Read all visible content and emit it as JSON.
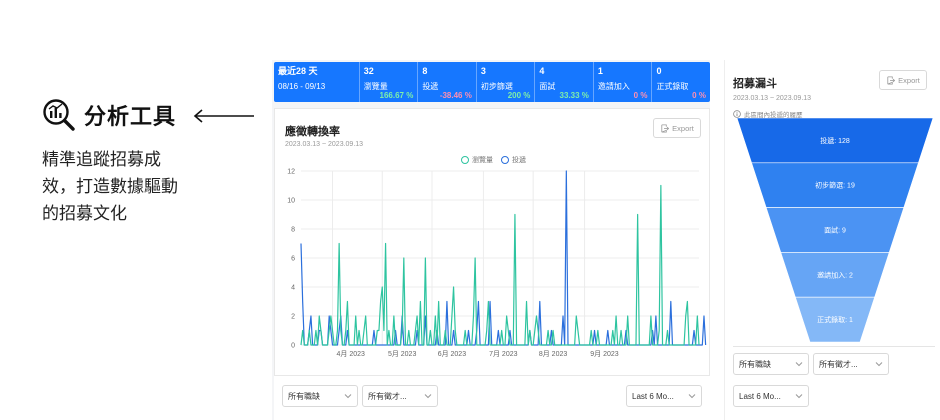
{
  "promo": {
    "title": "分析工具",
    "desc_lines": [
      "精準追蹤招募成",
      "效，打造數據驅動",
      "的招募文化"
    ]
  },
  "stats": [
    {
      "value": "最近28 天",
      "label": "08/16 - 09/13",
      "pct": "",
      "pct_color": "green"
    },
    {
      "value": "32",
      "label": "瀏覽量",
      "pct": "166.67 %",
      "pct_color": "green"
    },
    {
      "value": "8",
      "label": "投遞",
      "pct": "-38.46 %",
      "pct_color": "pink"
    },
    {
      "value": "3",
      "label": "初步篩選",
      "pct": "200 %",
      "pct_color": "green"
    },
    {
      "value": "4",
      "label": "面試",
      "pct": "33.33 %",
      "pct_color": "green"
    },
    {
      "value": "1",
      "label": "邀請加入",
      "pct": "0 %",
      "pct_color": "pink"
    },
    {
      "value": "0",
      "label": "正式錄取",
      "pct": "0 %",
      "pct_color": "pink"
    }
  ],
  "chart_card": {
    "title": "應徵轉換率",
    "date_range": "2023.03.13 ~ 2023.09.13",
    "export_label": "Export"
  },
  "chart_data": {
    "type": "line",
    "y_ticks": [
      "0",
      "2",
      "4",
      "6",
      "8",
      "10",
      "12"
    ],
    "ylim": [
      0,
      12
    ],
    "x_ticks": [
      "4月 2023",
      "5月 2023",
      "6月 2023",
      "7月 2023",
      "8月 2023",
      "9月 2023"
    ],
    "grid": true,
    "legend_position": "top-center",
    "series": [
      {
        "name": "瀏覽量",
        "color": "#2ec4a0",
        "values": [
          0,
          1,
          0,
          0,
          0,
          1,
          0,
          0,
          0,
          1,
          0,
          2,
          1,
          0,
          0,
          0,
          0,
          1,
          2,
          1,
          0,
          0,
          1,
          7,
          1,
          0,
          0,
          1,
          3,
          0,
          0,
          0,
          0,
          2,
          0,
          1,
          0,
          0,
          1,
          2,
          0,
          0,
          0,
          0,
          0,
          0,
          1,
          1,
          3,
          4,
          1,
          7,
          0,
          1,
          0,
          0,
          2,
          0,
          0,
          0,
          0,
          1,
          6,
          0,
          0,
          1,
          0,
          0,
          0,
          1,
          2,
          0,
          3,
          0,
          0,
          6,
          0,
          0,
          1,
          0,
          0,
          2,
          0,
          3,
          0,
          0,
          0,
          1,
          0,
          0,
          0,
          2,
          4,
          1,
          0,
          0,
          0,
          0,
          0,
          1,
          0,
          0,
          0,
          0,
          2,
          6,
          0,
          0,
          0,
          0,
          0,
          0,
          1,
          3,
          0,
          0,
          0,
          0,
          0,
          0,
          0,
          1,
          0,
          0,
          2,
          1,
          0,
          0,
          0,
          9,
          0,
          0,
          0,
          0,
          0,
          0,
          3,
          0,
          1,
          0,
          0,
          1,
          2,
          1,
          0,
          0,
          0,
          0,
          0,
          1,
          0,
          0,
          1,
          0,
          0,
          0,
          0,
          0,
          0,
          0,
          0,
          0,
          0,
          0,
          0,
          0,
          2,
          1,
          0,
          0,
          0,
          0,
          0,
          0,
          0,
          1,
          0,
          0,
          0,
          1,
          0,
          0,
          0,
          0,
          0,
          0,
          0,
          0,
          1,
          0,
          2,
          0,
          0,
          1,
          0,
          0,
          0,
          2,
          0,
          0,
          0,
          0,
          0,
          9,
          0,
          0,
          0,
          0,
          0,
          0,
          0,
          2,
          0,
          0,
          0,
          0,
          1,
          11,
          0,
          0,
          0,
          1,
          0,
          0,
          0,
          0,
          0,
          0,
          0,
          0,
          0,
          0,
          2,
          3,
          0,
          0,
          0,
          0,
          0,
          2,
          0
        ]
      },
      {
        "name": "投遞",
        "color": "#2b6fdc",
        "values": [
          7,
          3,
          0,
          0,
          0,
          1,
          2,
          0,
          0,
          0,
          0,
          1,
          1,
          0,
          0,
          0,
          0,
          2,
          1,
          0,
          0,
          0,
          0,
          1,
          2,
          0,
          0,
          0,
          1,
          0,
          0,
          0,
          0,
          0,
          0,
          0,
          0,
          0,
          0,
          0,
          0,
          0,
          0,
          0,
          1,
          0,
          0,
          0,
          0,
          0,
          0,
          0,
          0,
          0,
          0,
          0,
          0,
          1,
          0,
          0,
          0,
          2,
          0,
          0,
          0,
          0,
          0,
          0,
          0,
          0,
          1,
          0,
          0,
          0,
          0,
          2,
          0,
          0,
          0,
          0,
          0,
          0,
          1,
          0,
          0,
          0,
          0,
          0,
          3,
          0,
          0,
          0,
          1,
          0,
          0,
          0,
          0,
          0,
          0,
          0,
          0,
          1,
          0,
          0,
          0,
          0,
          1,
          3,
          0,
          0,
          0,
          0,
          0,
          0,
          3,
          0,
          0,
          0,
          0,
          1,
          0,
          0,
          0,
          0,
          0,
          0,
          1,
          0,
          0,
          0,
          0,
          0,
          0,
          0,
          0,
          0,
          0,
          0,
          1,
          0,
          0,
          0,
          0,
          0,
          3,
          0,
          0,
          0,
          0,
          0,
          0,
          1,
          0,
          0,
          0,
          0,
          0,
          0,
          2,
          0,
          12,
          0,
          0,
          0,
          0,
          0,
          0,
          0,
          0,
          0,
          0,
          0,
          0,
          0,
          0,
          0,
          0,
          1,
          0,
          0,
          0,
          0,
          0,
          0,
          0,
          1,
          0,
          0,
          0,
          0,
          0,
          0,
          0,
          0,
          0,
          0,
          1,
          0,
          0,
          0,
          0,
          0,
          0,
          0,
          0,
          0,
          0,
          0,
          0,
          0,
          0,
          0,
          1,
          0,
          2,
          0,
          0,
          0,
          0,
          0,
          0,
          0,
          0,
          3,
          0,
          0,
          0,
          0,
          0,
          0,
          0,
          0,
          0,
          0,
          0,
          0,
          0,
          1,
          0,
          0,
          0,
          0,
          0,
          2,
          0
        ]
      }
    ]
  },
  "filters_main": {
    "job": "所有職缺",
    "source": "所有徵才...",
    "period": "Last 6 Mo..."
  },
  "funnel": {
    "title": "招募漏斗",
    "date_range": "2023.03.13 ~ 2023.09.13",
    "export_label": "Export",
    "note": "此區間內投遞的履歷",
    "stages": [
      {
        "label": "投遞: 128",
        "value": 128,
        "color": "#1769e8"
      },
      {
        "label": "初步篩選: 19",
        "value": 19,
        "color": "#2f81f0"
      },
      {
        "label": "面試: 9",
        "value": 9,
        "color": "#4b93f3"
      },
      {
        "label": "邀請加入: 2",
        "value": 2,
        "color": "#66a5f5"
      },
      {
        "label": "正式錄取: 1",
        "value": 1,
        "color": "#84b8f7"
      }
    ],
    "filters": {
      "job": "所有職缺",
      "source": "所有徵才...",
      "period": "Last 6 Mo..."
    }
  }
}
